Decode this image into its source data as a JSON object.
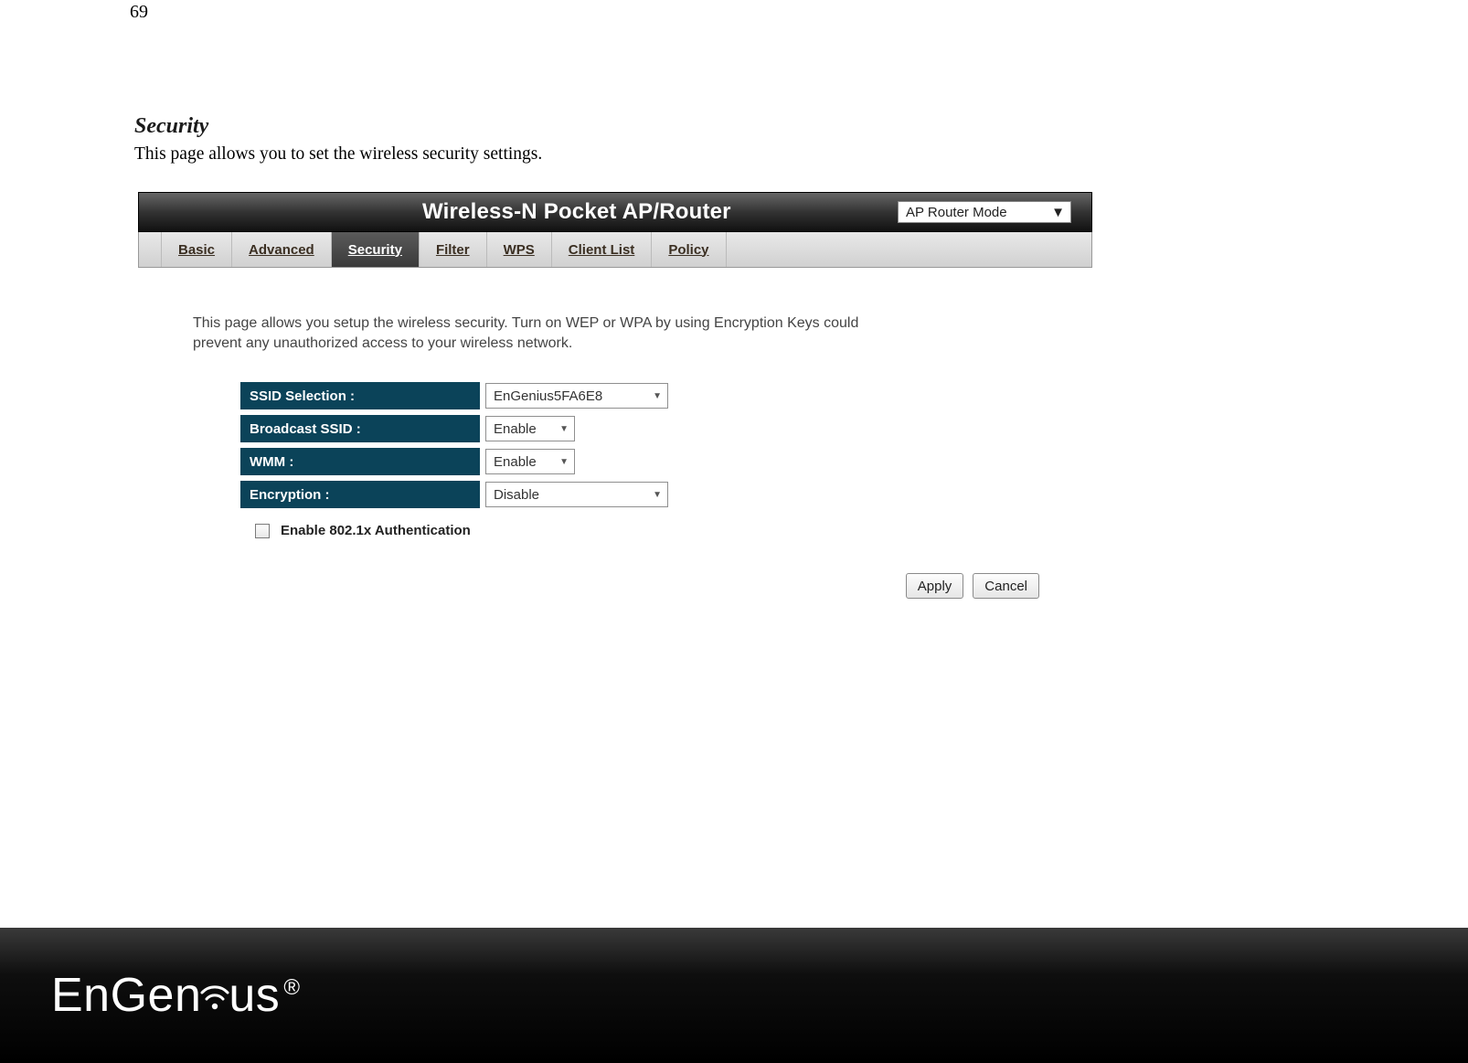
{
  "page_number": "69",
  "heading": "Security",
  "subheading": "This page allows you to set the wireless security settings.",
  "router_ui": {
    "title": "Wireless-N Pocket AP/Router",
    "mode_select_value": "AP Router Mode",
    "tabs": [
      "Basic",
      "Advanced",
      "Security",
      "Filter",
      "WPS",
      "Client List",
      "Policy"
    ],
    "active_tab": "Security",
    "description": "This page allows you setup the wireless security. Turn on WEP or WPA by using Encryption Keys could prevent any unauthorized access to your wireless network.",
    "rows": {
      "ssid_selection": {
        "label": "SSID Selection :",
        "value": "EnGenius5FA6E8"
      },
      "broadcast_ssid": {
        "label": "Broadcast SSID :",
        "value": "Enable"
      },
      "wmm": {
        "label": "WMM :",
        "value": "Enable"
      },
      "encryption": {
        "label": "Encryption :",
        "value": "Disable"
      }
    },
    "checkbox_label": "Enable 802.1x Authentication",
    "checkbox_checked": false,
    "apply_label": "Apply",
    "cancel_label": "Cancel"
  },
  "footer": {
    "brand_pre": "EnGen",
    "brand_post": "us",
    "reg": "®"
  }
}
